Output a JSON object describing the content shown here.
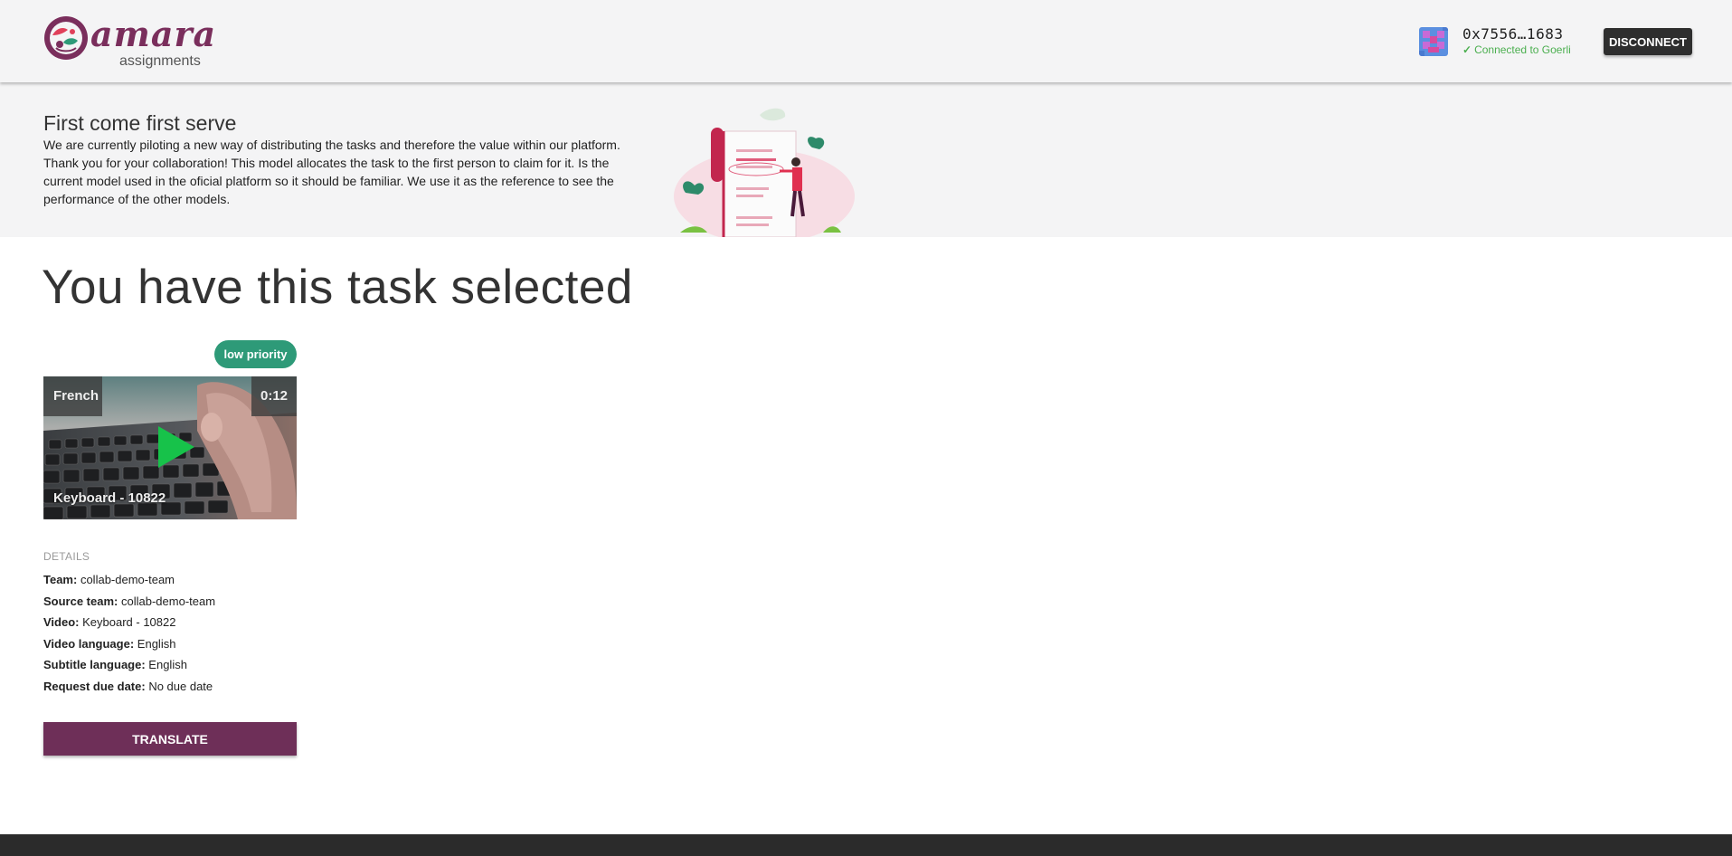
{
  "header": {
    "logo_word": "amara",
    "logo_subtitle": "assignments",
    "wallet_address": "0x7556…1683",
    "connection_status": "Connected to Goerli",
    "disconnect_label": "DISCONNECT"
  },
  "banner": {
    "title": "First come first serve",
    "text": "We are currently piloting a new way of distributing the tasks and therefore the value within our platform. Thank you for your collaboration! This model allocates the task to the first person to claim for it. Is the current model used in the oficial platform so it should be familiar. We use it as the reference to see the performance of the other models."
  },
  "main": {
    "title": "You have this task selected",
    "priority": "low priority",
    "video": {
      "language": "French",
      "duration": "0:12",
      "name": "Keyboard - 10822"
    },
    "details_heading": "DETAILS",
    "details": [
      {
        "label": "Team:",
        "value": "collab-demo-team"
      },
      {
        "label": "Source team:",
        "value": "collab-demo-team"
      },
      {
        "label": "Video:",
        "value": "Keyboard - 10822"
      },
      {
        "label": "Video language:",
        "value": "English"
      },
      {
        "label": "Subtitle language:",
        "value": "English"
      },
      {
        "label": "Request due date:",
        "value": "No due date"
      }
    ],
    "translate_label": "TRANSLATE"
  },
  "colors": {
    "brand": "#6e2f58",
    "priority": "#2e9a78",
    "connected": "#4caf50",
    "play": "#17c24a"
  },
  "icons": {
    "logo": "amara-logo-icon",
    "avatar": "wallet-avatar-icon",
    "status": "check-icon",
    "play": "play-icon",
    "illustration": "document-illustration"
  }
}
